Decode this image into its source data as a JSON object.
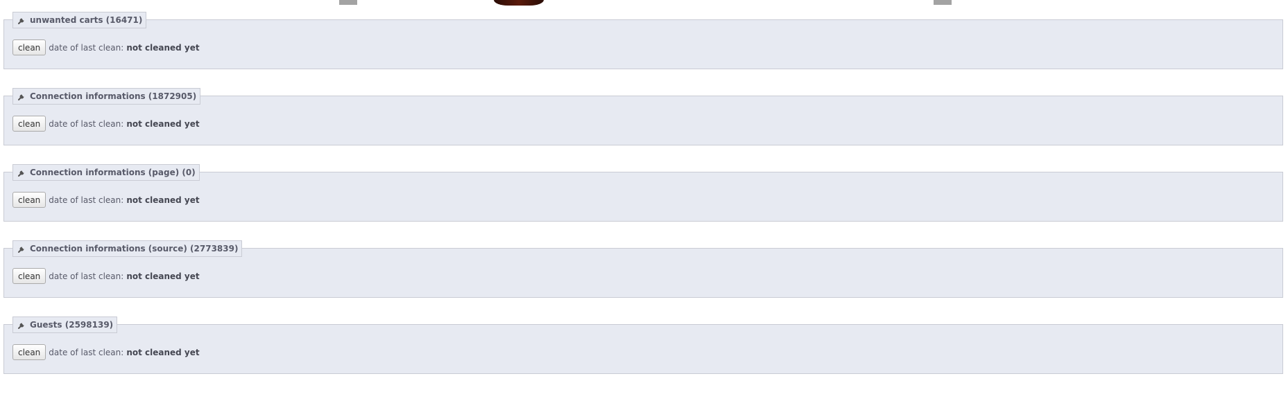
{
  "panels": [
    {
      "title": "unwanted carts (16471)",
      "button_label": "clean",
      "status_label": "date of last clean:",
      "status_value": "not cleaned yet"
    },
    {
      "title": "Connection informations (1872905)",
      "button_label": "clean",
      "status_label": "date of last clean:",
      "status_value": "not cleaned yet"
    },
    {
      "title": "Connection informations (page) (0)",
      "button_label": "clean",
      "status_label": "date of last clean:",
      "status_value": "not cleaned yet"
    },
    {
      "title": "Connection informations (source) (2773839)",
      "button_label": "clean",
      "status_label": "date of last clean:",
      "status_value": "not cleaned yet"
    },
    {
      "title": "Guests (2598139)",
      "button_label": "clean",
      "status_label": "date of last clean:",
      "status_value": "not cleaned yet"
    }
  ],
  "icons": {
    "panel_icon": "wrench-icon"
  },
  "colors": {
    "panel_background": "#e7eaf2",
    "panel_border": "#c9cbd4",
    "text": "#585a69"
  }
}
